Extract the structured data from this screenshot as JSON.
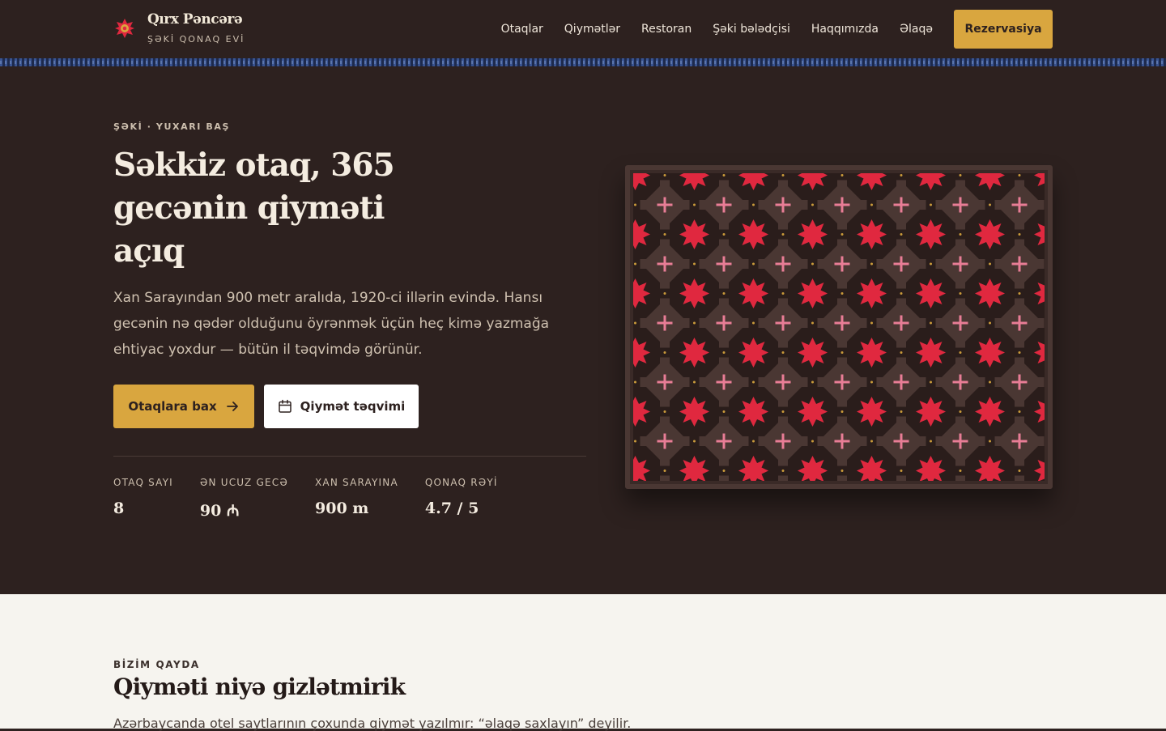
{
  "header": {
    "brand_name": "Qırx Pəncərə",
    "brand_sub": "ŞƏKİ QONAQ EVİ",
    "nav": [
      "Otaqlar",
      "Qiymətlər",
      "Restoran",
      "Şəki bələdçisi",
      "Haqqımızda",
      "Əlaqə"
    ],
    "cta": "Rezervasiya"
  },
  "hero": {
    "eyebrow": "ŞƏKİ · YUXARI BAŞ",
    "title": "Səkkiz otaq, 365 gecənin qiyməti açıq",
    "lead": "Xan Sarayından 900 metr aralıda, 1920-ci illərin evində. Hansı gecənin nə qədər olduğunu öyrənmək üçün heç kimə yazmağa ehtiyac yoxdur — bütün il təqvimdə görünür.",
    "primary_button": "Otaqlara bax",
    "secondary_button": "Qiymət təqvimi",
    "stats": [
      {
        "label": "OTAQ SAYI",
        "value": "8"
      },
      {
        "label": "ƏN UCUZ GECƏ",
        "value": "90 ₼"
      },
      {
        "label": "XAN SARAYINA",
        "value": "900 m"
      },
      {
        "label": "QONAQ RƏYİ",
        "value": "4.7 / 5"
      }
    ]
  },
  "section2": {
    "eyebrow": "BİZİM QAYDA",
    "title": "Qiyməti niyə gizlətmirik",
    "text": "Azərbaycanda otel saytlarının çoxunda qiymət yazılmır: “əlaqə saxlayın” deyilir."
  },
  "colors": {
    "background": "#2d211f",
    "accent": "#d9a63f",
    "carpet_red": "#e0283f",
    "carpet_pink": "#e87d96",
    "section_light": "#f6f4ef"
  },
  "icons": {
    "brand": "star-rosette-icon",
    "primary_button": "arrow-right-icon",
    "secondary_button": "calendar-icon"
  }
}
